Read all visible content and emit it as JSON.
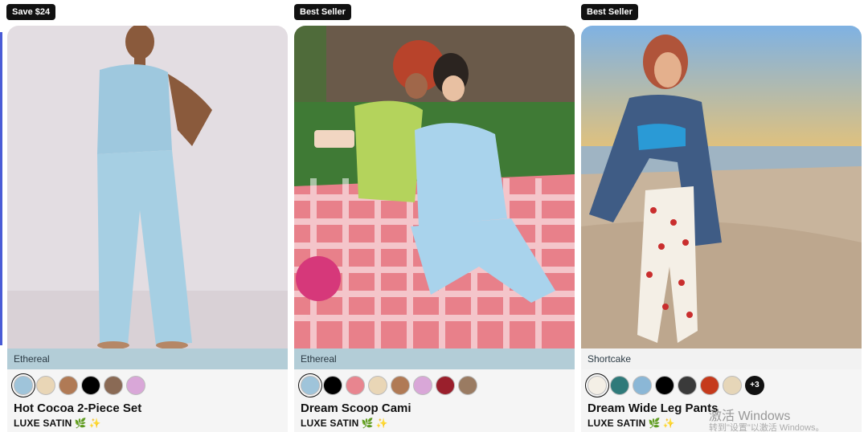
{
  "products": [
    {
      "badge": "Save $24",
      "print_name": "Ethereal",
      "print_bg": "#b3cdd7",
      "title": "Hot Cocoa 2-Piece Set",
      "fabric": "LUXE SATIN",
      "image_alt": "model wearing light blue satin cami and pants",
      "swatch_colors": [
        "#9fc4da",
        "#e9d6b6",
        "#b07a55",
        "#000000",
        "#8a6a55",
        "#d9a7d8"
      ],
      "more_label": ""
    },
    {
      "badge": "Best Seller",
      "print_name": "Ethereal",
      "print_bg": "#b3cdd7",
      "title": "Dream Scoop Cami",
      "fabric": "LUXE SATIN",
      "image_alt": "two models on a red gingham picnic blanket",
      "swatch_colors": [
        "#9fc4da",
        "#000000",
        "#e8858f",
        "#e9d6b6",
        "#b07a55",
        "#d9a7d8",
        "#9a1f2c",
        "#9a7b62"
      ],
      "more_label": ""
    },
    {
      "badge": "Best Seller",
      "print_name": "Shortcake",
      "print_bg": "#f2f2f2",
      "title": "Dream Wide Leg Pants",
      "fabric": "LUXE SATIN",
      "image_alt": "model on a beach at sunset wearing strawberry print pants",
      "swatch_colors": [
        "#f4efe6",
        "#2f7a7a",
        "#8bb7d6",
        "#000000",
        "#3a3a3a",
        "#c53a1c",
        "#e6d6b8"
      ],
      "more_label": "+3"
    }
  ],
  "watermark": {
    "line1": "激活 Windows",
    "line2": "转到\"设置\"以激活 Windows。"
  }
}
